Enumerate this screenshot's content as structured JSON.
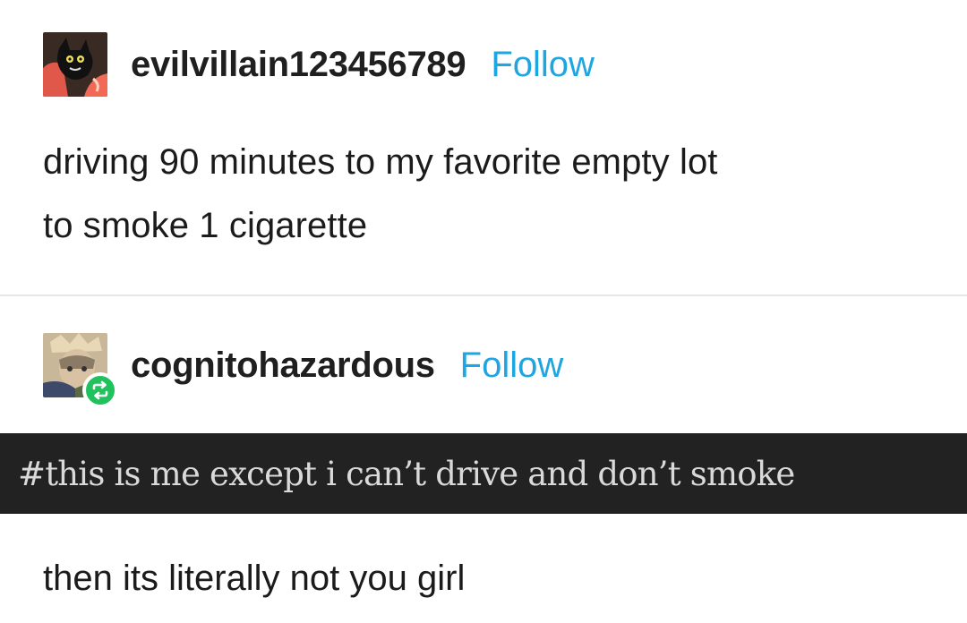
{
  "posts": [
    {
      "username": "evilvillain123456789",
      "follow_label": "Follow",
      "body_lines": [
        "driving 90 minutes to my favorite empty lot",
        "to smoke 1 cigarette"
      ]
    },
    {
      "username": "cognitohazardous",
      "follow_label": "Follow",
      "tags": "#this is me except i can’t drive and don’t smoke"
    }
  ],
  "reply_text": "then its literally not you girl",
  "colors": {
    "follow": "#1fa6e0",
    "reblog_badge": "#21c25e",
    "tags_bar": "#222222"
  },
  "icons": [
    "reblog-icon"
  ]
}
